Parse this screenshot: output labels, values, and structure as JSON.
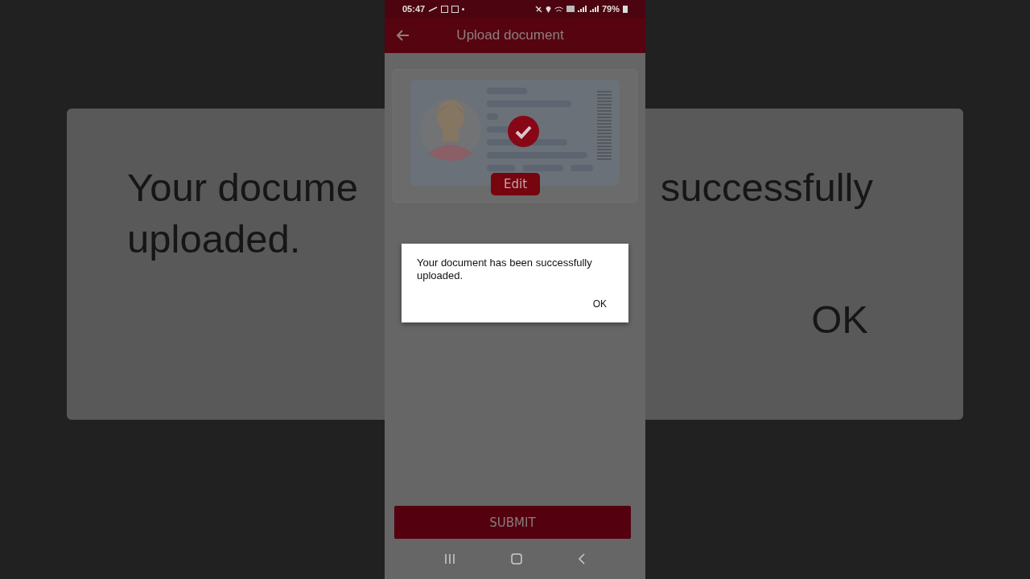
{
  "background_frame": {
    "message_left": "Your docume",
    "message_right": "successfully",
    "message_line_2": "uploaded.",
    "button": "OK"
  },
  "status_bar": {
    "time": "05:47",
    "battery": "79%"
  },
  "app_bar": {
    "title": "Upload document"
  },
  "document_card": {
    "verified": true,
    "edit_button": "Edit"
  },
  "submit_button": "SUBMIT",
  "dialog": {
    "message": "Your document has been successfully uploaded.",
    "button": "OK"
  }
}
